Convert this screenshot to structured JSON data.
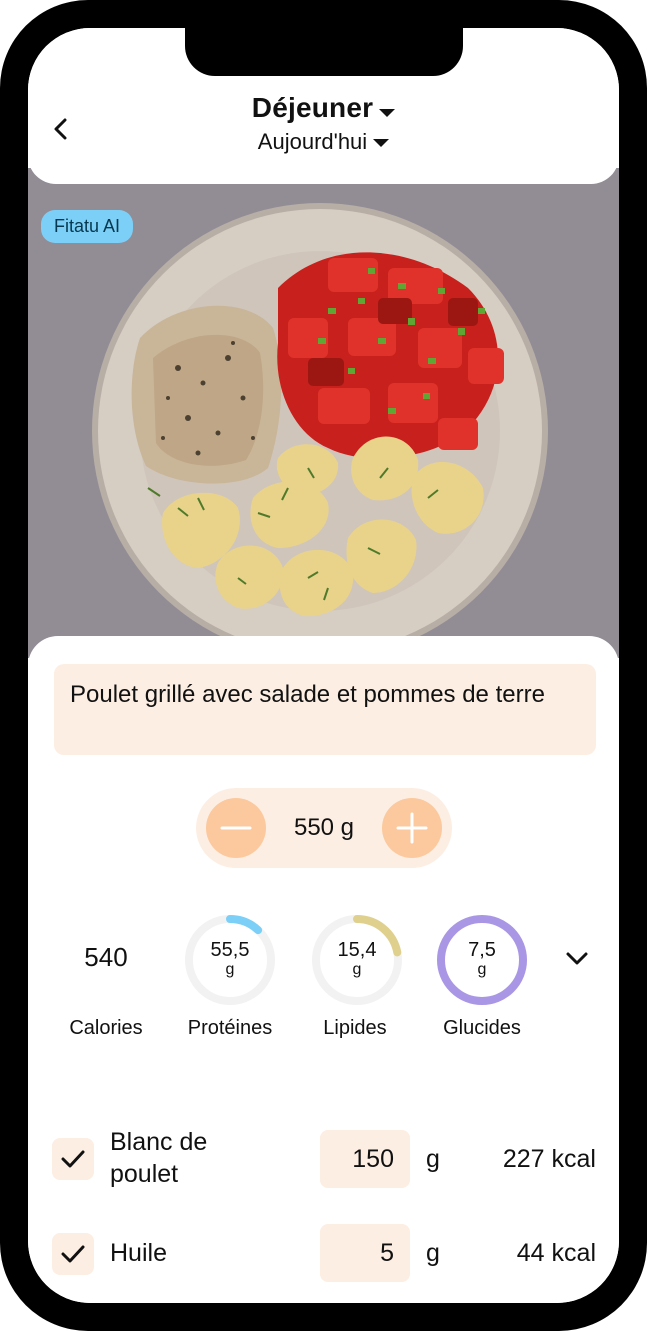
{
  "header": {
    "title": "Déjeuner",
    "subtitle": "Aujourd'hui"
  },
  "photo": {
    "badge": "Fitatu AI"
  },
  "meal": {
    "description": "Poulet grillé avec salade et pommes de terre",
    "portion": "550 g"
  },
  "macros": {
    "calories": {
      "value": "540",
      "label": "Calories"
    },
    "proteins": {
      "value": "55,5",
      "unit": "g",
      "label": "Protéines",
      "progress": 0.12,
      "color": "#7ccff7"
    },
    "lipids": {
      "value": "15,4",
      "unit": "g",
      "label": "Lipides",
      "progress": 0.22,
      "color": "#e0d08e"
    },
    "carbs": {
      "value": "7,5",
      "unit": "g",
      "label": "Glucides",
      "progress": 1.0,
      "color": "#a997e6"
    }
  },
  "ingredients": [
    {
      "name": "Blanc de poulet",
      "qty": "150",
      "unit": "g",
      "kcal": "227 kcal"
    },
    {
      "name": "Huile",
      "qty": "5",
      "unit": "g",
      "kcal": "44 kcal"
    }
  ],
  "colors": {
    "accent_bg": "#fdeee3",
    "accent_button": "#fbc99d",
    "badge": "#7ccff7"
  }
}
